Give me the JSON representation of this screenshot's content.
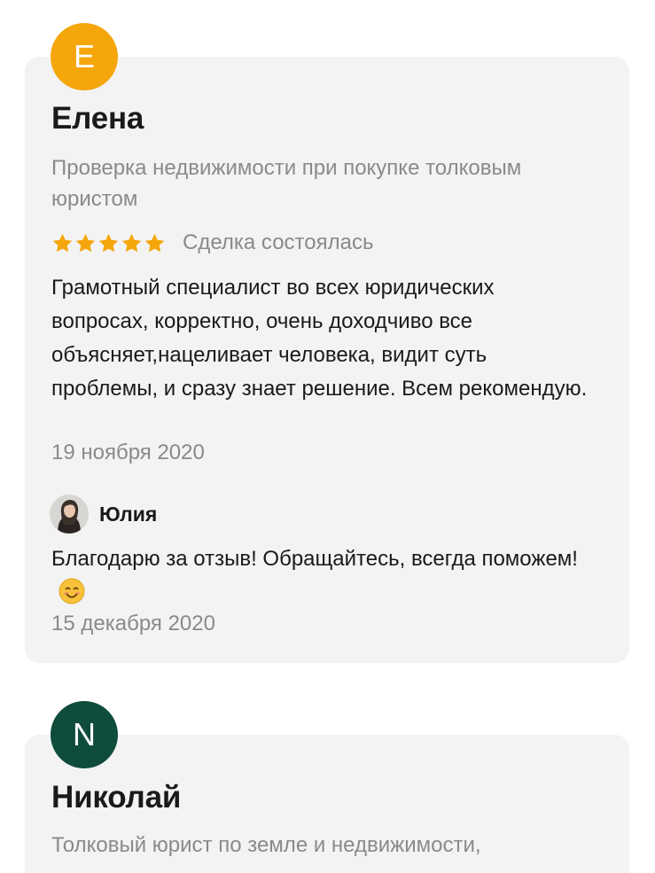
{
  "colors": {
    "card_bg": "#f3f3f3",
    "avatar_1": "#f5a60a",
    "avatar_2": "#0f4c3c",
    "star": "#f5a60a",
    "muted_text": "#8a8a8a",
    "main_text": "#1a1a1a"
  },
  "reviews": [
    {
      "avatar_letter": "Е",
      "author": "Елена",
      "service": "Проверка недвижимости при покупке толковым юристом",
      "rating": 5,
      "deal_status": "Сделка состоялась",
      "text": "Грамотный специалист во всех юридических вопросах, корректно,  очень доходчиво все объясняет,нацеливает человека, видит суть проблемы, и сразу знает решение. Всем рекомендую.",
      "date": "19 ноября 2020",
      "reply": {
        "author": "Юлия",
        "avatar_icon": "user-photo-avatar",
        "text": "Благодарю за отзыв! Обращайтесь, всегда поможем!",
        "emoji_icon": "smiling-face-icon",
        "date": "15 декабря 2020"
      }
    },
    {
      "avatar_letter": "N",
      "author": "Николай",
      "service": "Толковый юрист по земле и недвижимости,"
    }
  ]
}
